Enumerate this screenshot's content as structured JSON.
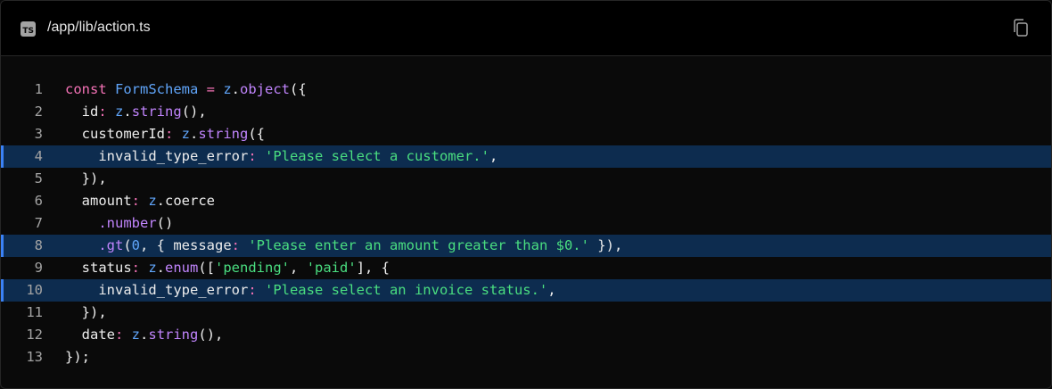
{
  "header": {
    "file_path": "/app/lib/action.ts",
    "lang_badge": "TS"
  },
  "icons": {
    "lang": "typescript-file-icon",
    "copy": "copy-icon"
  },
  "colors": {
    "keyword": "#f472b6",
    "identifier": "#60a5fa",
    "function": "#c084fc",
    "string": "#4ade80",
    "highlight": "#0d2c4f",
    "highlight_marker": "#3b82f6"
  },
  "code": {
    "lines": [
      {
        "number": "1",
        "tokens": [
          [
            "const ",
            "kw"
          ],
          [
            "FormSchema",
            "ty"
          ],
          [
            " = ",
            "kw"
          ],
          [
            "z",
            "ty"
          ],
          [
            ".",
            "pn"
          ],
          [
            "object",
            "fn"
          ],
          [
            "({",
            "pn"
          ]
        ]
      },
      {
        "number": "2",
        "tokens": [
          [
            "  id",
            "pn"
          ],
          [
            ": ",
            "kw"
          ],
          [
            "z",
            "ty"
          ],
          [
            ".",
            "pn"
          ],
          [
            "string",
            "fn"
          ],
          [
            "(),",
            "pn"
          ]
        ]
      },
      {
        "number": "3",
        "tokens": [
          [
            "  customerId",
            "pn"
          ],
          [
            ": ",
            "kw"
          ],
          [
            "z",
            "ty"
          ],
          [
            ".",
            "pn"
          ],
          [
            "string",
            "fn"
          ],
          [
            "({",
            "pn"
          ]
        ]
      },
      {
        "number": "4",
        "highlight": true,
        "tokens": [
          [
            "    invalid_type_error",
            "pn"
          ],
          [
            ": ",
            "kw"
          ],
          [
            "'Please select a customer.'",
            "str"
          ],
          [
            ",",
            "pn"
          ]
        ]
      },
      {
        "number": "5",
        "tokens": [
          [
            "  }),",
            "pn"
          ]
        ]
      },
      {
        "number": "6",
        "tokens": [
          [
            "  amount",
            "pn"
          ],
          [
            ": ",
            "kw"
          ],
          [
            "z",
            "ty"
          ],
          [
            ".coerce",
            "pn"
          ]
        ]
      },
      {
        "number": "7",
        "tokens": [
          [
            "    ",
            "pn"
          ],
          [
            ".number",
            "fn"
          ],
          [
            "()",
            "pn"
          ]
        ]
      },
      {
        "number": "8",
        "highlight": true,
        "tokens": [
          [
            "    ",
            "pn"
          ],
          [
            ".gt",
            "fn"
          ],
          [
            "(",
            "pn"
          ],
          [
            "0",
            "num"
          ],
          [
            ", { message",
            "pn"
          ],
          [
            ": ",
            "kw"
          ],
          [
            "'Please enter an amount greater than $0.'",
            "str"
          ],
          [
            " }),",
            "pn"
          ]
        ]
      },
      {
        "number": "9",
        "tokens": [
          [
            "  status",
            "pn"
          ],
          [
            ": ",
            "kw"
          ],
          [
            "z",
            "ty"
          ],
          [
            ".",
            "pn"
          ],
          [
            "enum",
            "fn"
          ],
          [
            "([",
            "pn"
          ],
          [
            "'pending'",
            "str"
          ],
          [
            ", ",
            "pn"
          ],
          [
            "'paid'",
            "str"
          ],
          [
            "], {",
            "pn"
          ]
        ]
      },
      {
        "number": "10",
        "highlight": true,
        "tokens": [
          [
            "    invalid_type_error",
            "pn"
          ],
          [
            ": ",
            "kw"
          ],
          [
            "'Please select an invoice status.'",
            "str"
          ],
          [
            ",",
            "pn"
          ]
        ]
      },
      {
        "number": "11",
        "tokens": [
          [
            "  }),",
            "pn"
          ]
        ]
      },
      {
        "number": "12",
        "tokens": [
          [
            "  date",
            "pn"
          ],
          [
            ": ",
            "kw"
          ],
          [
            "z",
            "ty"
          ],
          [
            ".",
            "pn"
          ],
          [
            "string",
            "fn"
          ],
          [
            "(),",
            "pn"
          ]
        ]
      },
      {
        "number": "13",
        "tokens": [
          [
            "});",
            "pn"
          ]
        ]
      }
    ]
  }
}
